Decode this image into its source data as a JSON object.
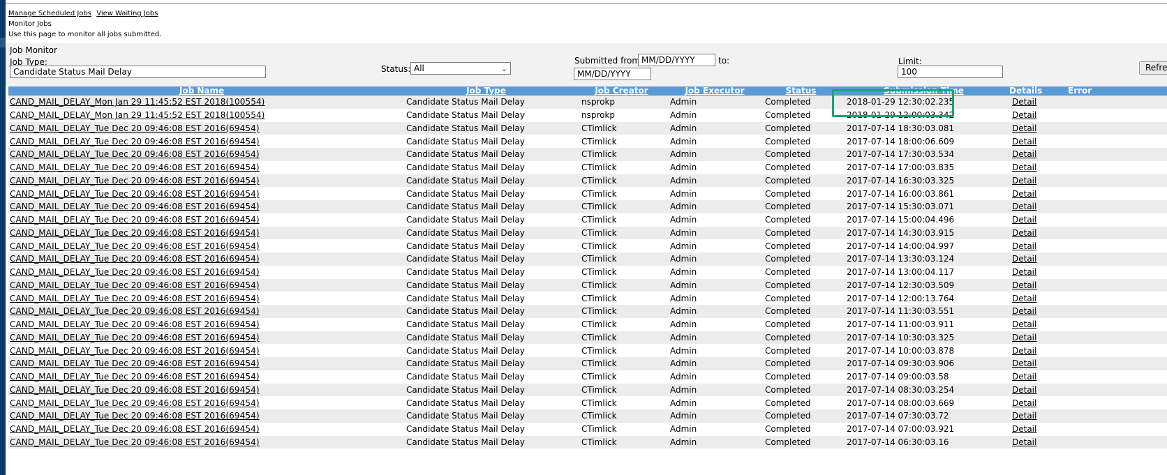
{
  "nav": {
    "links": [
      "Manage Scheduled Jobs",
      "View Waiting Jobs"
    ],
    "page_title": "Monitor Jobs",
    "description": "Use this page to monitor all jobs submitted."
  },
  "panel": {
    "title": "Job Monitor",
    "job_type_label": "Job Type:",
    "job_type_value": "Candidate Status Mail Delay",
    "status_label": "Status:",
    "status_value": "All",
    "submitted_from_label": "Submitted from:",
    "submitted_from_value": "MM/DD/YYYY",
    "to_label": "to:",
    "to_value": "MM/DD/YYYY",
    "limit_label": "Limit:",
    "limit_value": "100",
    "refresh_label": "Refresh"
  },
  "table": {
    "columns": [
      "Job Name",
      "Job Type",
      "Job Creator",
      "Job Executor",
      "Status",
      "Submission Time",
      "Details",
      "Error"
    ],
    "rows": [
      [
        "CAND_MAIL_DELAY_Mon Jan 29 11:45:52 EST 2018(100554)",
        "Candidate Status Mail Delay",
        "nsprokp",
        "Admin",
        "Completed",
        "2018-01-29 12:30:02.235",
        "Detail"
      ],
      [
        "CAND_MAIL_DELAY_Mon Jan 29 11:45:52 EST 2018(100554)",
        "Candidate Status Mail Delay",
        "nsprokp",
        "Admin",
        "Completed",
        "2018-01-29 12:00:03.342",
        "Detail"
      ],
      [
        "CAND_MAIL_DELAY_Tue Dec 20 09:46:08 EST 2016(69454)",
        "Candidate Status Mail Delay",
        "CTimlick",
        "Admin",
        "Completed",
        "2017-07-14 18:30:03.081",
        "Detail"
      ],
      [
        "CAND_MAIL_DELAY_Tue Dec 20 09:46:08 EST 2016(69454)",
        "Candidate Status Mail Delay",
        "CTimlick",
        "Admin",
        "Completed",
        "2017-07-14 18:00:06.609",
        "Detail"
      ],
      [
        "CAND_MAIL_DELAY_Tue Dec 20 09:46:08 EST 2016(69454)",
        "Candidate Status Mail Delay",
        "CTimlick",
        "Admin",
        "Completed",
        "2017-07-14 17:30:03.534",
        "Detail"
      ],
      [
        "CAND_MAIL_DELAY_Tue Dec 20 09:46:08 EST 2016(69454)",
        "Candidate Status Mail Delay",
        "CTimlick",
        "Admin",
        "Completed",
        "2017-07-14 17:00:03.835",
        "Detail"
      ],
      [
        "CAND_MAIL_DELAY_Tue Dec 20 09:46:08 EST 2016(69454)",
        "Candidate Status Mail Delay",
        "CTimlick",
        "Admin",
        "Completed",
        "2017-07-14 16:30:03.325",
        "Detail"
      ],
      [
        "CAND_MAIL_DELAY_Tue Dec 20 09:46:08 EST 2016(69454)",
        "Candidate Status Mail Delay",
        "CTimlick",
        "Admin",
        "Completed",
        "2017-07-14 16:00:03.861",
        "Detail"
      ],
      [
        "CAND_MAIL_DELAY_Tue Dec 20 09:46:08 EST 2016(69454)",
        "Candidate Status Mail Delay",
        "CTimlick",
        "Admin",
        "Completed",
        "2017-07-14 15:30:03.071",
        "Detail"
      ],
      [
        "CAND_MAIL_DELAY_Tue Dec 20 09:46:08 EST 2016(69454)",
        "Candidate Status Mail Delay",
        "CTimlick",
        "Admin",
        "Completed",
        "2017-07-14 15:00:04.496",
        "Detail"
      ],
      [
        "CAND_MAIL_DELAY_Tue Dec 20 09:46:08 EST 2016(69454)",
        "Candidate Status Mail Delay",
        "CTimlick",
        "Admin",
        "Completed",
        "2017-07-14 14:30:03.915",
        "Detail"
      ],
      [
        "CAND_MAIL_DELAY_Tue Dec 20 09:46:08 EST 2016(69454)",
        "Candidate Status Mail Delay",
        "CTimlick",
        "Admin",
        "Completed",
        "2017-07-14 14:00:04.997",
        "Detail"
      ],
      [
        "CAND_MAIL_DELAY_Tue Dec 20 09:46:08 EST 2016(69454)",
        "Candidate Status Mail Delay",
        "CTimlick",
        "Admin",
        "Completed",
        "2017-07-14 13:30:03.124",
        "Detail"
      ],
      [
        "CAND_MAIL_DELAY_Tue Dec 20 09:46:08 EST 2016(69454)",
        "Candidate Status Mail Delay",
        "CTimlick",
        "Admin",
        "Completed",
        "2017-07-14 13:00:04.117",
        "Detail"
      ],
      [
        "CAND_MAIL_DELAY_Tue Dec 20 09:46:08 EST 2016(69454)",
        "Candidate Status Mail Delay",
        "CTimlick",
        "Admin",
        "Completed",
        "2017-07-14 12:30:03.509",
        "Detail"
      ],
      [
        "CAND_MAIL_DELAY_Tue Dec 20 09:46:08 EST 2016(69454)",
        "Candidate Status Mail Delay",
        "CTimlick",
        "Admin",
        "Completed",
        "2017-07-14 12:00:13.764",
        "Detail"
      ],
      [
        "CAND_MAIL_DELAY_Tue Dec 20 09:46:08 EST 2016(69454)",
        "Candidate Status Mail Delay",
        "CTimlick",
        "Admin",
        "Completed",
        "2017-07-14 11:30:03.551",
        "Detail"
      ],
      [
        "CAND_MAIL_DELAY_Tue Dec 20 09:46:08 EST 2016(69454)",
        "Candidate Status Mail Delay",
        "CTimlick",
        "Admin",
        "Completed",
        "2017-07-14 11:00:03.911",
        "Detail"
      ],
      [
        "CAND_MAIL_DELAY_Tue Dec 20 09:46:08 EST 2016(69454)",
        "Candidate Status Mail Delay",
        "CTimlick",
        "Admin",
        "Completed",
        "2017-07-14 10:30:03.325",
        "Detail"
      ],
      [
        "CAND_MAIL_DELAY_Tue Dec 20 09:46:08 EST 2016(69454)",
        "Candidate Status Mail Delay",
        "CTimlick",
        "Admin",
        "Completed",
        "2017-07-14 10:00:03.878",
        "Detail"
      ],
      [
        "CAND_MAIL_DELAY_Tue Dec 20 09:46:08 EST 2016(69454)",
        "Candidate Status Mail Delay",
        "CTimlick",
        "Admin",
        "Completed",
        "2017-07-14 09:30:03.906",
        "Detail"
      ],
      [
        "CAND_MAIL_DELAY_Tue Dec 20 09:46:08 EST 2016(69454)",
        "Candidate Status Mail Delay",
        "CTimlick",
        "Admin",
        "Completed",
        "2017-07-14 09:00:03.58",
        "Detail"
      ],
      [
        "CAND_MAIL_DELAY_Tue Dec 20 09:46:08 EST 2016(69454)",
        "Candidate Status Mail Delay",
        "CTimlick",
        "Admin",
        "Completed",
        "2017-07-14 08:30:03.254",
        "Detail"
      ],
      [
        "CAND_MAIL_DELAY_Tue Dec 20 09:46:08 EST 2016(69454)",
        "Candidate Status Mail Delay",
        "CTimlick",
        "Admin",
        "Completed",
        "2017-07-14 08:00:03.669",
        "Detail"
      ],
      [
        "CAND_MAIL_DELAY_Tue Dec 20 09:46:08 EST 2016(69454)",
        "Candidate Status Mail Delay",
        "CTimlick",
        "Admin",
        "Completed",
        "2017-07-14 07:30:03.72",
        "Detail"
      ],
      [
        "CAND_MAIL_DELAY_Tue Dec 20 09:46:08 EST 2016(69454)",
        "Candidate Status Mail Delay",
        "CTimlick",
        "Admin",
        "Completed",
        "2017-07-14 07:00:03.921",
        "Detail"
      ],
      [
        "CAND_MAIL_DELAY_Tue Dec 20 09:46:08 EST 2016(69454)",
        "Candidate Status Mail Delay",
        "CTimlick",
        "Admin",
        "Completed",
        "2017-07-14 06:30:03.16",
        "Detail"
      ]
    ]
  },
  "colors": {
    "header_bg": "#5b9bd5",
    "highlight_border": "#17a37a",
    "sidebar": "#0b3a66"
  }
}
